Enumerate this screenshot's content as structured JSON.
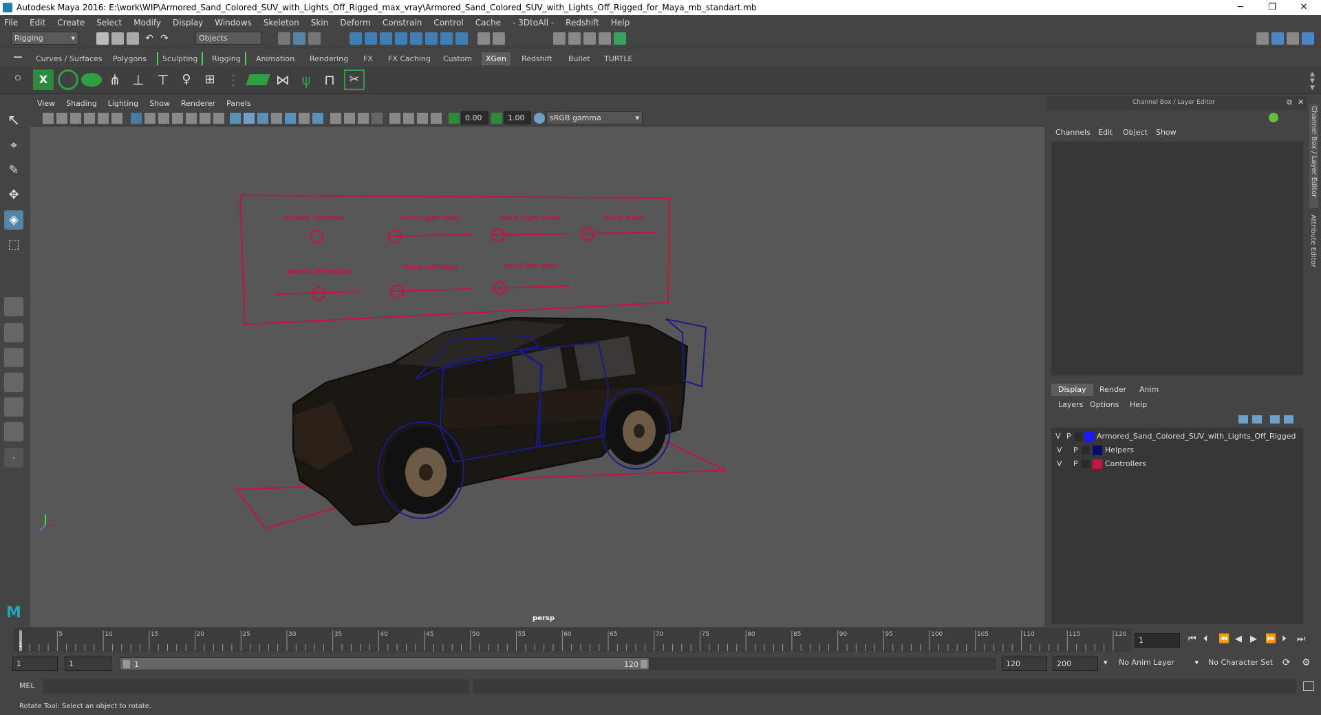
{
  "window": {
    "title": "Autodesk Maya 2016: E:\\work\\WIP\\Armored_Sand_Colored_SUV_with_Lights_Off_Rigged_max_vray\\Armored_Sand_Colored_SUV_with_Lights_Off_Rigged_for_Maya_mb_standart.mb",
    "minimize": "─",
    "restore": "❐",
    "close": "✕"
  },
  "menu": [
    "File",
    "Edit",
    "Create",
    "Select",
    "Modify",
    "Display",
    "Windows",
    "Skeleton",
    "Skin",
    "Deform",
    "Constrain",
    "Control",
    "Cache",
    "- 3DtoAll -",
    "Redshift",
    "Help"
  ],
  "status": {
    "mode": "Rigging",
    "selection_mask": "Objects"
  },
  "shelf_tabs": [
    {
      "label": "Curves / Surfaces",
      "active": false
    },
    {
      "label": "Polygons",
      "active": false
    },
    {
      "label": "Sculpting",
      "active": false
    },
    {
      "label": "Rigging",
      "active": false
    },
    {
      "label": "Animation",
      "active": false
    },
    {
      "label": "Rendering",
      "active": false
    },
    {
      "label": "FX",
      "active": false
    },
    {
      "label": "FX Caching",
      "active": false
    },
    {
      "label": "Custom",
      "active": false
    },
    {
      "label": "XGen",
      "active": true
    },
    {
      "label": "Redshift",
      "active": false
    },
    {
      "label": "Bullet",
      "active": false
    },
    {
      "label": "TURTLE",
      "active": false
    }
  ],
  "viewport": {
    "menu": [
      "View",
      "Shading",
      "Lighting",
      "Show",
      "Renderer",
      "Panels"
    ],
    "exposure": "0.00",
    "gamma": "1.00",
    "color_space": "sRGB gamma",
    "camera_label": "persp",
    "control_labels": {
      "wheels_rotation": "wheels rotation",
      "front_right_door": "front right door",
      "back_right_door": "back right door",
      "back_door": "back door",
      "wheels_direction": "wheels direction",
      "front_left_door": "front left door",
      "back_left_door": "back left door"
    },
    "colors": {
      "controller": "#c4143f",
      "helper": "#1a1a8c",
      "background": "#575757"
    }
  },
  "channel_box": {
    "title": "Channel Box / Layer Editor",
    "menu": [
      "Channels",
      "Edit",
      "Object",
      "Show"
    ],
    "layer_tabs": [
      "Display",
      "Render",
      "Anim"
    ],
    "layer_menu": [
      "Layers",
      "Options",
      "Help"
    ],
    "layers": [
      {
        "v": "V",
        "p": "P",
        "color": "#1a1aff",
        "name": "Armored_Sand_Colored_SUV_with_Lights_Off_Rigged"
      },
      {
        "v": "V",
        "p": "P",
        "color": "#0a0a6e",
        "name": "Helpers"
      },
      {
        "v": "V",
        "p": "P",
        "color": "#c4143f",
        "name": "Controllers"
      }
    ]
  },
  "side_tabs": [
    "Channel Box / Layer Editor",
    "Attribute Editor"
  ],
  "timeline": {
    "ticks": [
      "5",
      "10",
      "15",
      "20",
      "25",
      "30",
      "35",
      "40",
      "45",
      "50",
      "55",
      "60",
      "65",
      "70",
      "75",
      "80",
      "85",
      "90",
      "95",
      "100",
      "105",
      "110",
      "115",
      "120"
    ],
    "current_frame_marker": "1",
    "current_frame_field": "1"
  },
  "range": {
    "start": "1",
    "playback_start": "1",
    "slider_start": "1",
    "slider_end": "120",
    "playback_end": "120",
    "end": "200",
    "anim_layer": "No Anim Layer",
    "character_set": "No Character Set"
  },
  "command": {
    "label": "MEL"
  },
  "help_line": "Rotate Tool: Select an object to rotate."
}
